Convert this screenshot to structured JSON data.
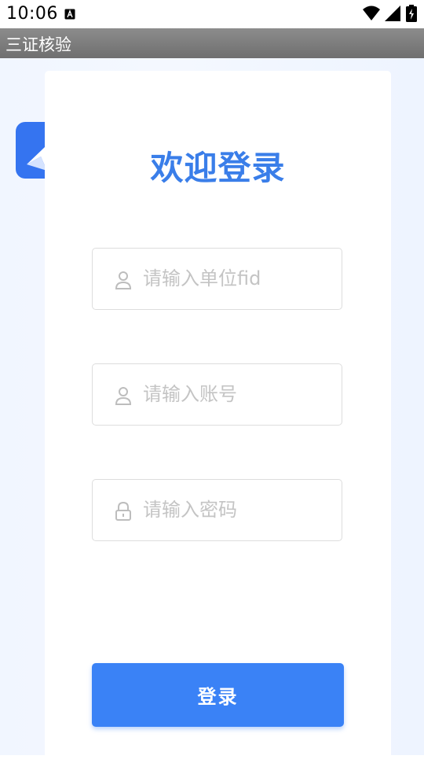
{
  "status_bar": {
    "time": "10:06",
    "icons": [
      "notification-a-icon",
      "wifi-icon",
      "signal-icon",
      "battery-icon"
    ]
  },
  "app": {
    "title": "三证核验"
  },
  "login": {
    "welcome": "欢迎登录",
    "unit_field": {
      "placeholder": "请输入单位fid",
      "value": "",
      "icon": "user-icon"
    },
    "account_field": {
      "placeholder": "请输入账号",
      "value": "",
      "icon": "user-icon"
    },
    "password_field": {
      "placeholder": "请输入密码",
      "value": "",
      "icon": "lock-icon"
    },
    "submit_label": "登录"
  },
  "colors": {
    "accent": "#3a82f6",
    "title_text": "#3a7ee9",
    "title_bar": "#7d7d7d",
    "background": "#f2f6ff"
  }
}
